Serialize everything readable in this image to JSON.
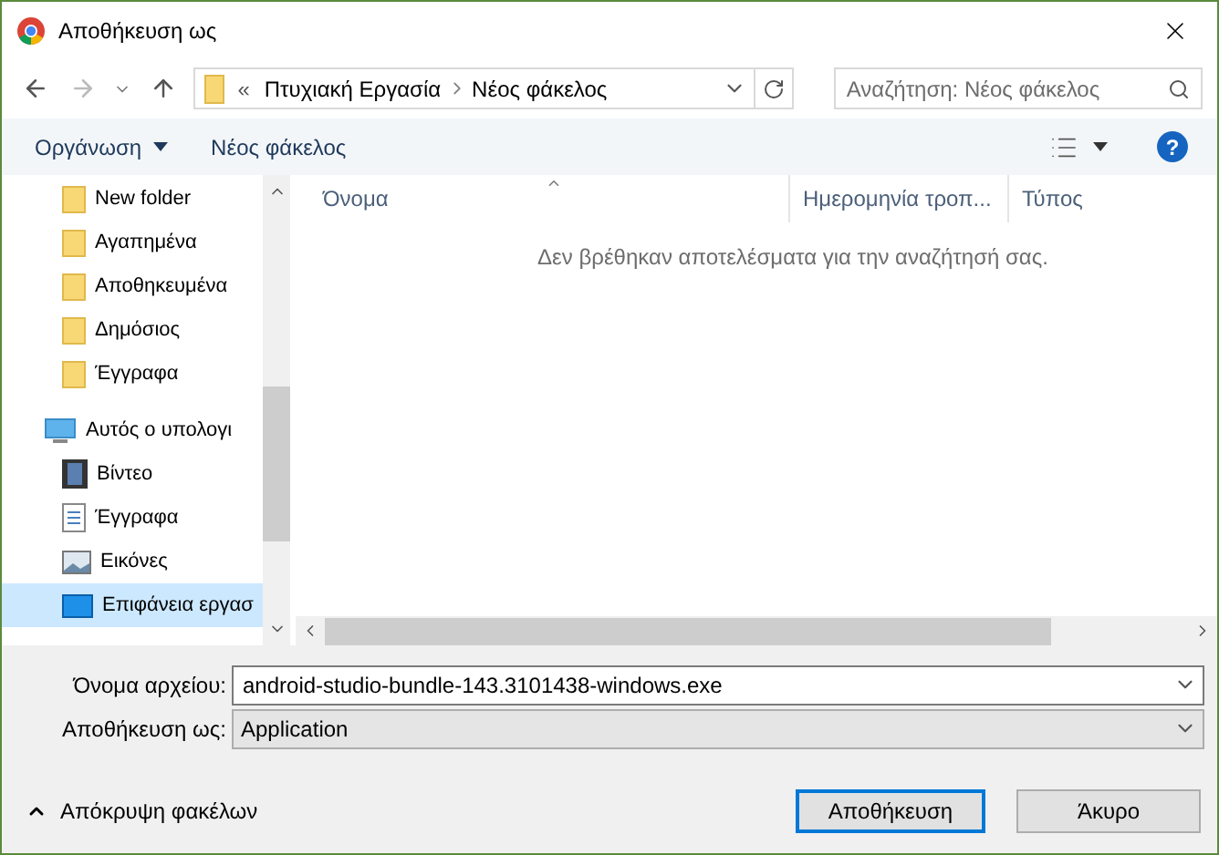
{
  "window": {
    "title": "Αποθήκευση ως"
  },
  "address": {
    "overflow": "«",
    "crumbs": [
      "Πτυχιακή Εργασία",
      "Νέος φάκελος"
    ]
  },
  "search": {
    "placeholder": "Αναζήτηση: Νέος φάκελος"
  },
  "toolbar": {
    "organize": "Οργάνωση",
    "new_folder": "Νέος φάκελος",
    "help": "?"
  },
  "tree": [
    {
      "label": "New folder",
      "kind": "folder",
      "selected": false
    },
    {
      "label": "Αγαπημένα",
      "kind": "folder",
      "selected": false
    },
    {
      "label": "Αποθηκευμένα",
      "kind": "folder",
      "selected": false
    },
    {
      "label": "Δημόσιος",
      "kind": "folder",
      "selected": false
    },
    {
      "label": "Έγγραφα",
      "kind": "folder",
      "selected": false
    },
    {
      "label": "Αυτός ο υπολογι",
      "kind": "pc",
      "selected": false,
      "children": [
        {
          "label": "Βίντεο",
          "kind": "video",
          "selected": false
        },
        {
          "label": "Έγγραφα",
          "kind": "doc",
          "selected": false
        },
        {
          "label": "Εικόνες",
          "kind": "picture",
          "selected": false
        },
        {
          "label": "Επιφάνεια εργασ",
          "kind": "desktop",
          "selected": true
        }
      ]
    }
  ],
  "table": {
    "columns": [
      "Όνομα",
      "Ημερομηνία τροπ...",
      "Τύπος"
    ],
    "empty_message": "Δεν βρέθηκαν αποτελέσματα για την αναζήτησή σας."
  },
  "file_name": {
    "label": "Όνομα αρχείου:",
    "value": "android-studio-bundle-143.3101438-windows.exe"
  },
  "save_type": {
    "label": "Αποθήκευση ως:",
    "value": "Application"
  },
  "hide_folders": "Απόκρυψη φακέλων",
  "buttons": [
    {
      "label": "Αποθήκευση",
      "kind": "primary"
    },
    {
      "label": "Άκυρο",
      "kind": "normal"
    }
  ]
}
